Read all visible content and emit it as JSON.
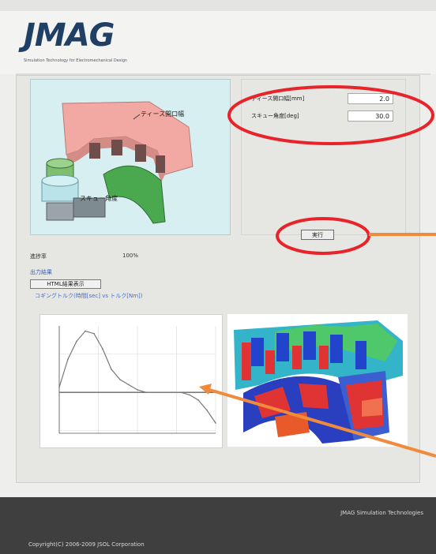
{
  "header": {
    "logo": "JMAG",
    "tagline": "Simulation Technology for Electromechanical Design"
  },
  "model_view": {
    "label_teeth": "ティース開口幅",
    "label_skew": "スキュー角度"
  },
  "params": [
    {
      "label": "ティース開口幅[mm]",
      "value": "2.0"
    },
    {
      "label": "スキュー角度[deg]",
      "value": "30.0"
    }
  ],
  "run_button": "実行",
  "progress": {
    "label": "進捗率",
    "value": "100%"
  },
  "output": {
    "section_label": "出力結果",
    "html_button": "HTML結果表示",
    "plot_title": "コギングトルク(時間[sec] vs トルク[Nm])"
  },
  "footer": {
    "brand": "JMAG Simulation Technologies",
    "copyright": "Copyright(C) 2006-2009 JSOL Corporation"
  },
  "chart_data": {
    "type": "line",
    "x": [
      0,
      5,
      10,
      15,
      20,
      25,
      30,
      35,
      40,
      45,
      50,
      55,
      60,
      65,
      70,
      75,
      80,
      85,
      90
    ],
    "series": [
      {
        "values": [
          0.2,
          1.3,
          2.0,
          2.4,
          2.3,
          1.7,
          0.9,
          0.5,
          0.3,
          0.1,
          0.0,
          0.0,
          0.0,
          0.0,
          0.0,
          -0.1,
          -0.3,
          -0.7,
          -1.2
        ]
      }
    ],
    "ylim": [
      -1.6,
      2.6
    ],
    "xlim": [
      0,
      90
    ],
    "grid": true
  },
  "colors": {
    "annotation_ellipse": "#e8232a",
    "annotation_arrow": "#f08a3c",
    "header_logo": "#1f3f64",
    "footer_bg": "#3f3f3f"
  },
  "icons": {
    "viewer": "motor-model-icon",
    "field": "flux-density-contour-icon"
  }
}
